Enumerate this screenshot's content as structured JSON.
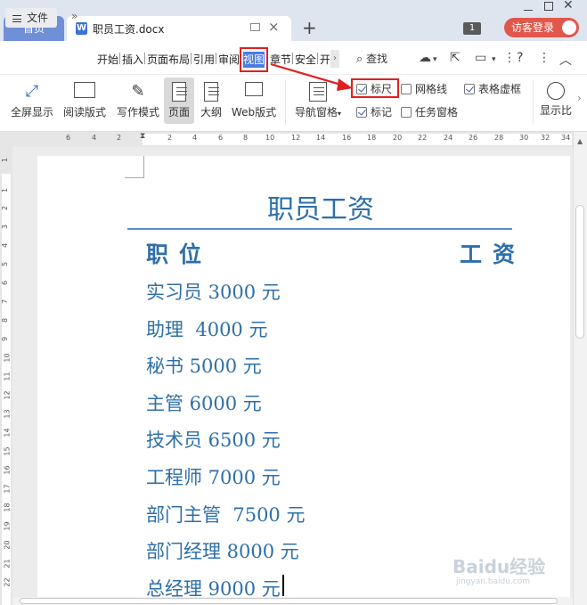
{
  "tabs": {
    "home": "首页",
    "document": "职员工资.docx",
    "badge": "1",
    "login": "访客登录"
  },
  "menu": {
    "file": "文件",
    "items": [
      "开始",
      "插入",
      "页面布局",
      "引用",
      "审阅",
      "视图",
      "章节",
      "安全",
      "开"
    ],
    "search": "查找"
  },
  "ribbon": {
    "fullscreen": "全屏显示",
    "reading": "阅读版式",
    "writing": "写作模式",
    "page": "页面",
    "outline": "大纲",
    "web": "Web版式",
    "nav": "导航窗格",
    "ruler": "标尺",
    "gridlines": "网格线",
    "table_gridlines": "表格虚框",
    "marks": "标记",
    "task_pane": "任务窗格",
    "zoom": "显示比"
  },
  "checks": {
    "ruler": true,
    "gridlines": false,
    "table_gridlines": true,
    "marks": true,
    "task_pane": false
  },
  "hruler_numbers": [
    "6",
    "4",
    "2",
    "2",
    "4",
    "6",
    "8",
    "10",
    "12",
    "14",
    "16",
    "18",
    "20",
    "22",
    "24",
    "26",
    "28",
    "30",
    "32",
    "34"
  ],
  "vruler_numbers": [
    "1",
    "1",
    "2",
    "3",
    "4",
    "5",
    "6",
    "7",
    "8",
    "9",
    "10",
    "11",
    "12",
    "13",
    "14",
    "15",
    "16",
    "17",
    "18",
    "19",
    "20",
    "21",
    "22"
  ],
  "document": {
    "title": "职员工资",
    "col_position": "职位",
    "col_salary": "工资",
    "lines": [
      "实习员 3000 元",
      "助理  4000 元",
      "秘书 5000 元",
      "主管 6000 元",
      "技术员 6500 元",
      "工程师 7000 元",
      "部门主管  7500 元",
      "部门经理 8000 元",
      "总经理 9000 元"
    ]
  },
  "watermark": {
    "brand": "Baidu经验",
    "url": "jingyan.baidu.com"
  }
}
